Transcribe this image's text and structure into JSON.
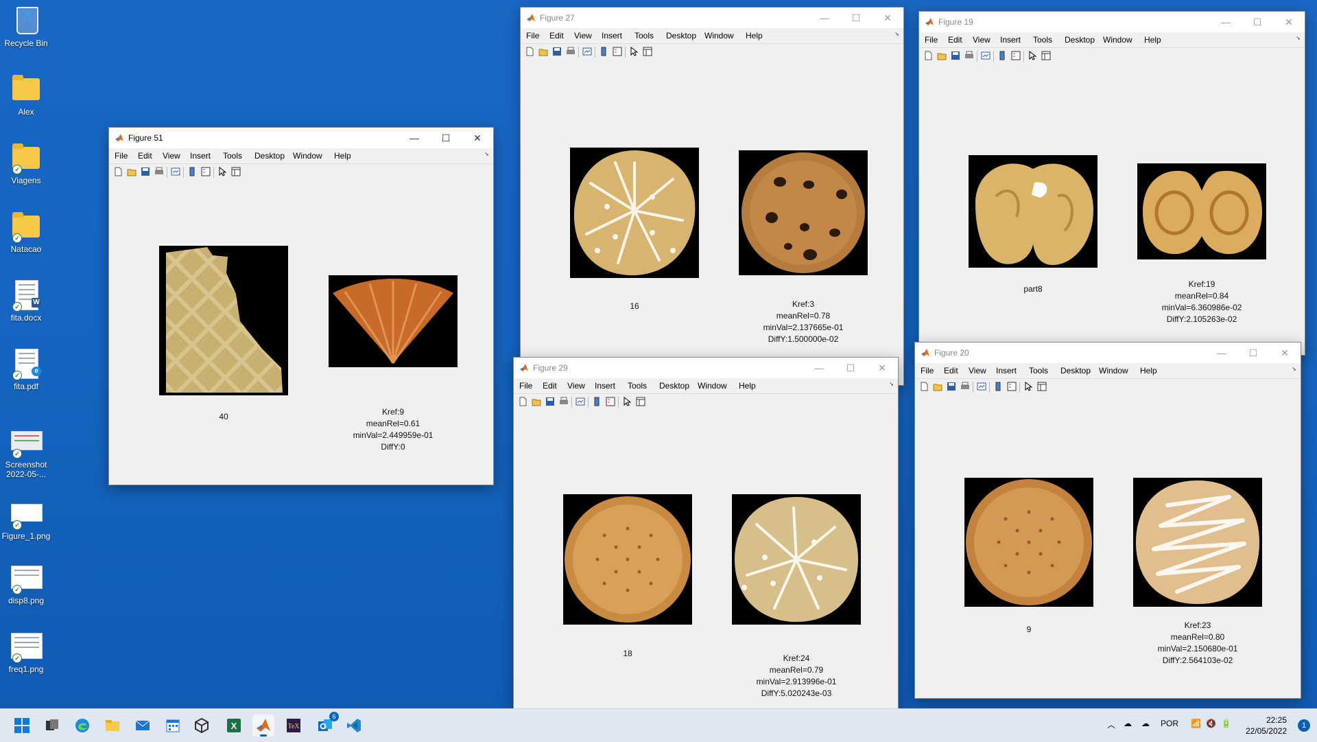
{
  "desktop_icons": [
    {
      "label": "Recycle Bin",
      "icon": "recycle-bin-icon"
    },
    {
      "label": "Alex",
      "icon": "folder-icon"
    },
    {
      "label": "Viagens",
      "icon": "folder-icon"
    },
    {
      "label": "Natacao",
      "icon": "folder-icon"
    },
    {
      "label": "fita.docx",
      "icon": "word-document-icon"
    },
    {
      "label": "fita.pdf",
      "icon": "pdf-document-icon"
    },
    {
      "label": "Screenshot 2022-05-...",
      "icon": "image-file-icon"
    },
    {
      "label": "Figure_1.png",
      "icon": "image-file-icon"
    },
    {
      "label": "disp8.png",
      "icon": "image-file-icon"
    },
    {
      "label": "freq1.png",
      "icon": "image-file-icon"
    }
  ],
  "menu": [
    "File",
    "Edit",
    "View",
    "Insert",
    "Tools",
    "Desktop",
    "Window",
    "Help"
  ],
  "toolbar_icons": [
    "new-figure-icon",
    "open-file-icon",
    "save-icon",
    "print-icon",
    "link-plot-icon",
    "insert-colorbar-icon",
    "insert-legend-icon",
    "edit-plot-icon",
    "property-inspector-icon"
  ],
  "window_controls": {
    "minimize": "—",
    "maximize": "☐",
    "close": "✕"
  },
  "windows": {
    "fig51": {
      "title": "Figure 51",
      "left_caption": "40",
      "right_caption": [
        "Kref:9",
        "meanRel=0.61",
        "minVal=2.449959e-01",
        "DiffY:0"
      ]
    },
    "fig27": {
      "title": "Figure 27",
      "left_caption": "16",
      "right_caption": [
        "Kref:3",
        "meanRel=0.78",
        "minVal=2.137665e-01",
        "DiffY:1.500000e-02"
      ]
    },
    "fig29": {
      "title": "Figure 29",
      "left_caption": "18",
      "right_caption": [
        "Kref:24",
        "meanRel=0.79",
        "minVal=2.913996e-01",
        "DiffY:5.020243e-03"
      ]
    },
    "fig19": {
      "title": "Figure 19",
      "left_caption": "part8",
      "right_caption": [
        "Kref:19",
        "meanRel=0.84",
        "minVal=6.360986e-02",
        "DiffY:2.105263e-02"
      ]
    },
    "fig20": {
      "title": "Figure 20",
      "left_caption": "9",
      "right_caption": [
        "Kref:23",
        "meanRel=0.80",
        "minVal=2.150680e-01",
        "DiffY:2.564103e-02"
      ]
    }
  },
  "taskbar": {
    "apps": [
      "start-icon",
      "task-view-icon",
      "edge-icon",
      "file-explorer-icon",
      "mail-icon",
      "calendar-icon",
      "3d-viewer-icon",
      "excel-icon",
      "matlab-icon",
      "tex-editor-icon",
      "outlook-icon",
      "vscode-icon"
    ],
    "badge": "6",
    "language": "POR",
    "time": "22:25",
    "date": "22/05/2022",
    "notifications": "1"
  }
}
